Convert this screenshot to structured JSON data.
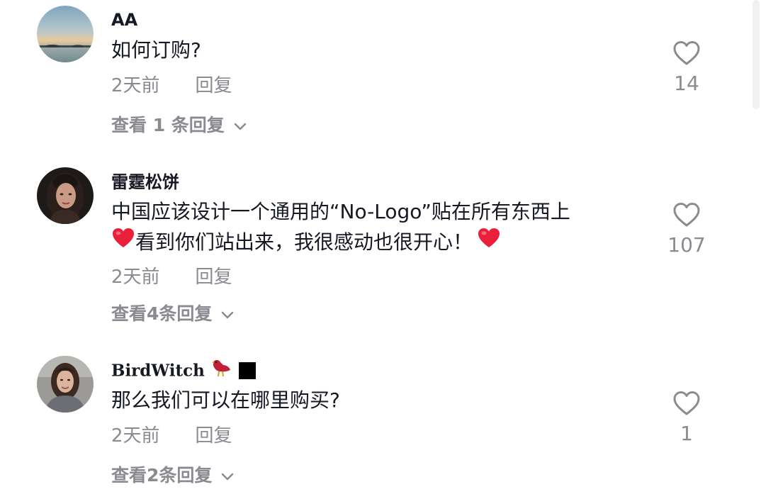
{
  "comments": [
    {
      "username": "AA",
      "text_lines": [
        "如何订购?"
      ],
      "time": "2天前",
      "reply_label": "回复",
      "view_replies": "查看 1 条回复",
      "likes": "14",
      "avatar": "sunset-avatar"
    },
    {
      "username": "雷霆松饼",
      "text_lines": [
        "中国应该设计一个通用的“No-Logo”贴在所有东西上",
        "看到你们站出来，我很感动也很开心！"
      ],
      "time": "2天前",
      "reply_label": "回复",
      "view_replies": "查看4条回复",
      "likes": "107",
      "avatar": "woman-dark-hair-avatar"
    },
    {
      "username": "BirdWitch",
      "text_lines": [
        "那么我们可以在哪里购买?"
      ],
      "time": "2天前",
      "reply_label": "回复",
      "view_replies": "查看2条回复",
      "likes": "1",
      "avatar": "woman-avatar"
    }
  ],
  "colors": {
    "primary_text": "#161823",
    "secondary_text": "#8a8b91",
    "heart_emoji": "#e8203a"
  }
}
